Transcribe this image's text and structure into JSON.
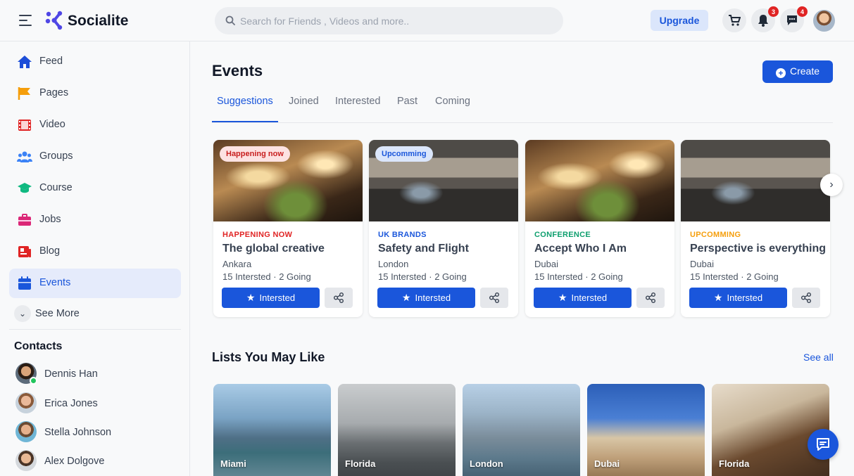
{
  "header": {
    "app_name": "Socialite",
    "search_placeholder": "Search for Friends , Videos and more..",
    "upgrade_label": "Upgrade",
    "notifications_count": "3",
    "messages_count": "4",
    "icons": [
      "menu-icon",
      "logo-icon",
      "search-icon",
      "cart-icon",
      "bell-icon",
      "message-icon",
      "avatar"
    ]
  },
  "sidebar": {
    "items": [
      {
        "label": "Feed",
        "icon": "home-icon",
        "color": "#1d4ed8"
      },
      {
        "label": "Pages",
        "icon": "flag-icon",
        "color": "#f59e0b"
      },
      {
        "label": "Video",
        "icon": "film-icon",
        "color": "#e02424"
      },
      {
        "label": "Groups",
        "icon": "users-icon",
        "color": "#3b82f6"
      },
      {
        "label": "Course",
        "icon": "graduation-cap-icon",
        "color": "#10b981"
      },
      {
        "label": "Jobs",
        "icon": "briefcase-icon",
        "color": "#db2777"
      },
      {
        "label": "Blog",
        "icon": "blog-icon",
        "color": "#e02424"
      },
      {
        "label": "Events",
        "icon": "calendar-icon",
        "color": "#1a56db",
        "active": true
      }
    ],
    "see_more": "See More",
    "contacts_title": "Contacts",
    "contacts": [
      {
        "name": "Dennis Han",
        "online": true
      },
      {
        "name": "Erica Jones"
      },
      {
        "name": "Stella Johnson"
      },
      {
        "name": "Alex Dolgove"
      }
    ]
  },
  "main": {
    "title": "Events",
    "create_label": "Create",
    "tabs": [
      "Suggestions",
      "Joined",
      "Interested",
      "Past",
      "Coming"
    ],
    "active_tab": "Suggestions",
    "events": [
      {
        "badge": "Happening now",
        "category": "HAPPENING NOW",
        "title": "The global creative",
        "location": "Ankara",
        "stats": "15 Intersted · 2 Going",
        "button": "Intersted",
        "cat_color": "#e02424"
      },
      {
        "badge": "Upcomming",
        "category": "UK BRANDS",
        "title": "Safety and Flight",
        "location": "London",
        "stats": "15 Intersted · 2 Going",
        "button": "Intersted",
        "cat_color": "#1a56db"
      },
      {
        "badge": "",
        "category": "CONFERENCE",
        "title": "Accept Who I Am",
        "location": "Dubai",
        "stats": "15 Intersted · 2 Going",
        "button": "Intersted",
        "cat_color": "#0e9f6e"
      },
      {
        "badge": "",
        "category": "UPCOMMING",
        "title": "Perspective is everything",
        "location": "Dubai",
        "stats": "15 Intersted · 2 Going",
        "button": "Intersted",
        "cat_color": "#f59e0b"
      }
    ],
    "lists_title": "Lists You May Like",
    "see_all": "See all",
    "lists": [
      {
        "label": "Miami"
      },
      {
        "label": "Florida"
      },
      {
        "label": "London"
      },
      {
        "label": "Dubai"
      },
      {
        "label": "Florida"
      }
    ]
  },
  "colors": {
    "accent": "#1a56db",
    "badge_red": "#e02424"
  }
}
